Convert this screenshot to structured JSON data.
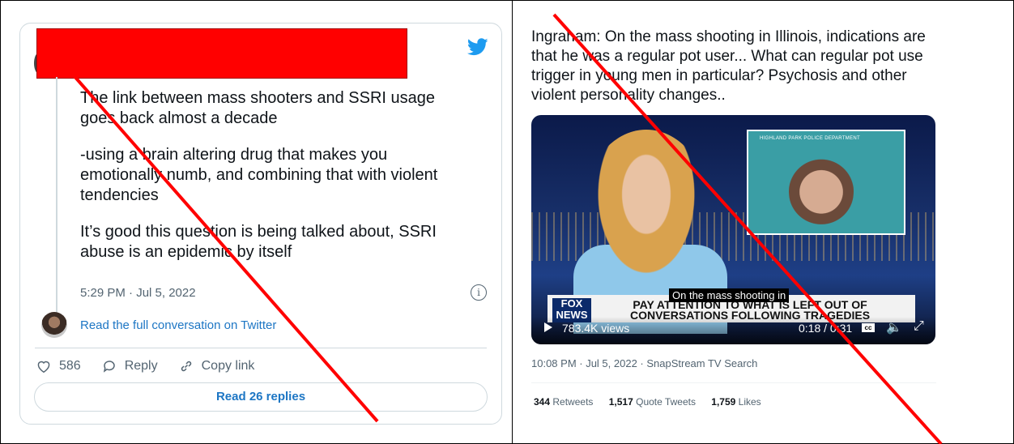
{
  "left_tweet": {
    "paragraphs": [
      "The link between mass shooters and SSRI usage goes back almost a decade",
      "-using a brain altering drug that makes you emotionally numb, and combining that with violent tendencies",
      "It’s good this question is being talked about, SSRI abuse is an epidemic by itself"
    ],
    "timestamp": "5:29 PM · Jul 5, 2022",
    "read_conversation": "Read the full conversation on Twitter",
    "like_count": "586",
    "reply_label": "Reply",
    "copy_link_label": "Copy link",
    "read_replies": "Read 26 replies"
  },
  "right_tweet": {
    "text": "Ingraham: On the mass shooting in Illinois, indications are that he was a regular pot user... What can regular pot use trigger in young men in particular? Psychosis and other violent personality changes..",
    "video": {
      "inset_label": "HIGHLAND PARK POLICE DEPARTMENT",
      "banner": "PAY ATTENTION TO WHAT IS LEFT OUT OF CONVERSATIONS FOLLOWING TRAGEDIES",
      "network": "FOX NEWS",
      "caption": "On the mass shooting in",
      "views": "783.4K views",
      "time": "0:18 / 0:31",
      "cc": "cc"
    },
    "meta": "10:08 PM · Jul 5, 2022 · SnapStream TV Search",
    "retweets_count": "344",
    "retweets_label": "Retweets",
    "quote_count": "1,517",
    "quote_label": "Quote Tweets",
    "likes_count": "1,759",
    "likes_label": "Likes"
  },
  "colors": {
    "link": "#1d76c4",
    "redaction": "#ff0000",
    "slash": "#ff0000",
    "twitter_blue": "#1d9bf0"
  },
  "icons": [
    "twitter-bird-icon",
    "info-icon",
    "heart-icon",
    "reply-icon",
    "link-icon",
    "play-icon",
    "volume-icon",
    "fullscreen-icon"
  ]
}
